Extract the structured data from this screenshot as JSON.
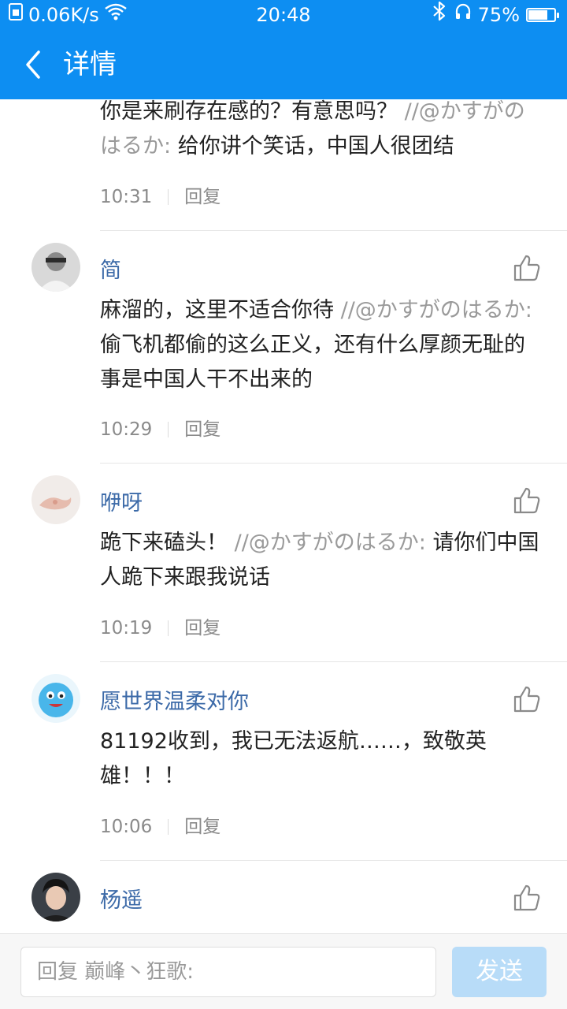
{
  "status_bar": {
    "speed": "0.06K/s",
    "time": "20:48",
    "battery_percent": "75%",
    "battery_level": 0.75
  },
  "header": {
    "back_icon": "back-arrow-icon",
    "title": "详情"
  },
  "comments": [
    {
      "name": "",
      "text": "你是来刷存在感的？有意思吗？",
      "quote": "//@かすがのはるか:",
      "quote_text": "给你讲个笑话，中国人很团结",
      "time": "10:31",
      "reply": "回复"
    },
    {
      "name": "简",
      "avatar": "avatar-jian",
      "text": "麻溜的，这里不适合你待",
      "quote": "//@かすがのはるか:",
      "quote_text": "偷飞机都偷的这么正义，还有什么厚颜无耻的事是中国人干不出来的",
      "time": "10:29",
      "reply": "回复"
    },
    {
      "name": "咿呀",
      "avatar": "avatar-hand",
      "text": "跪下来磕头！",
      "quote": "//@かすがのはるか:",
      "quote_text": "请你们中国人跪下来跟我说话",
      "time": "10:19",
      "reply": "回复"
    },
    {
      "name": "愿世界温柔对你",
      "avatar": "avatar-cartoon",
      "text": "81192收到，我已无法返航……，致敬英雄！！！",
      "quote": "",
      "quote_text": "",
      "time": "10:06",
      "reply": "回复"
    },
    {
      "name": "杨遥",
      "avatar": "avatar-person",
      "text": "",
      "time": "",
      "reply": ""
    }
  ],
  "reply_bar": {
    "placeholder": "回复 巅峰丶狂歌:",
    "send_label": "发送"
  },
  "colors": {
    "header_bg": "#0d8ef2",
    "username": "#3c6aa8",
    "quote": "#9a9a9a",
    "send_disabled": "#b8dcf8"
  }
}
